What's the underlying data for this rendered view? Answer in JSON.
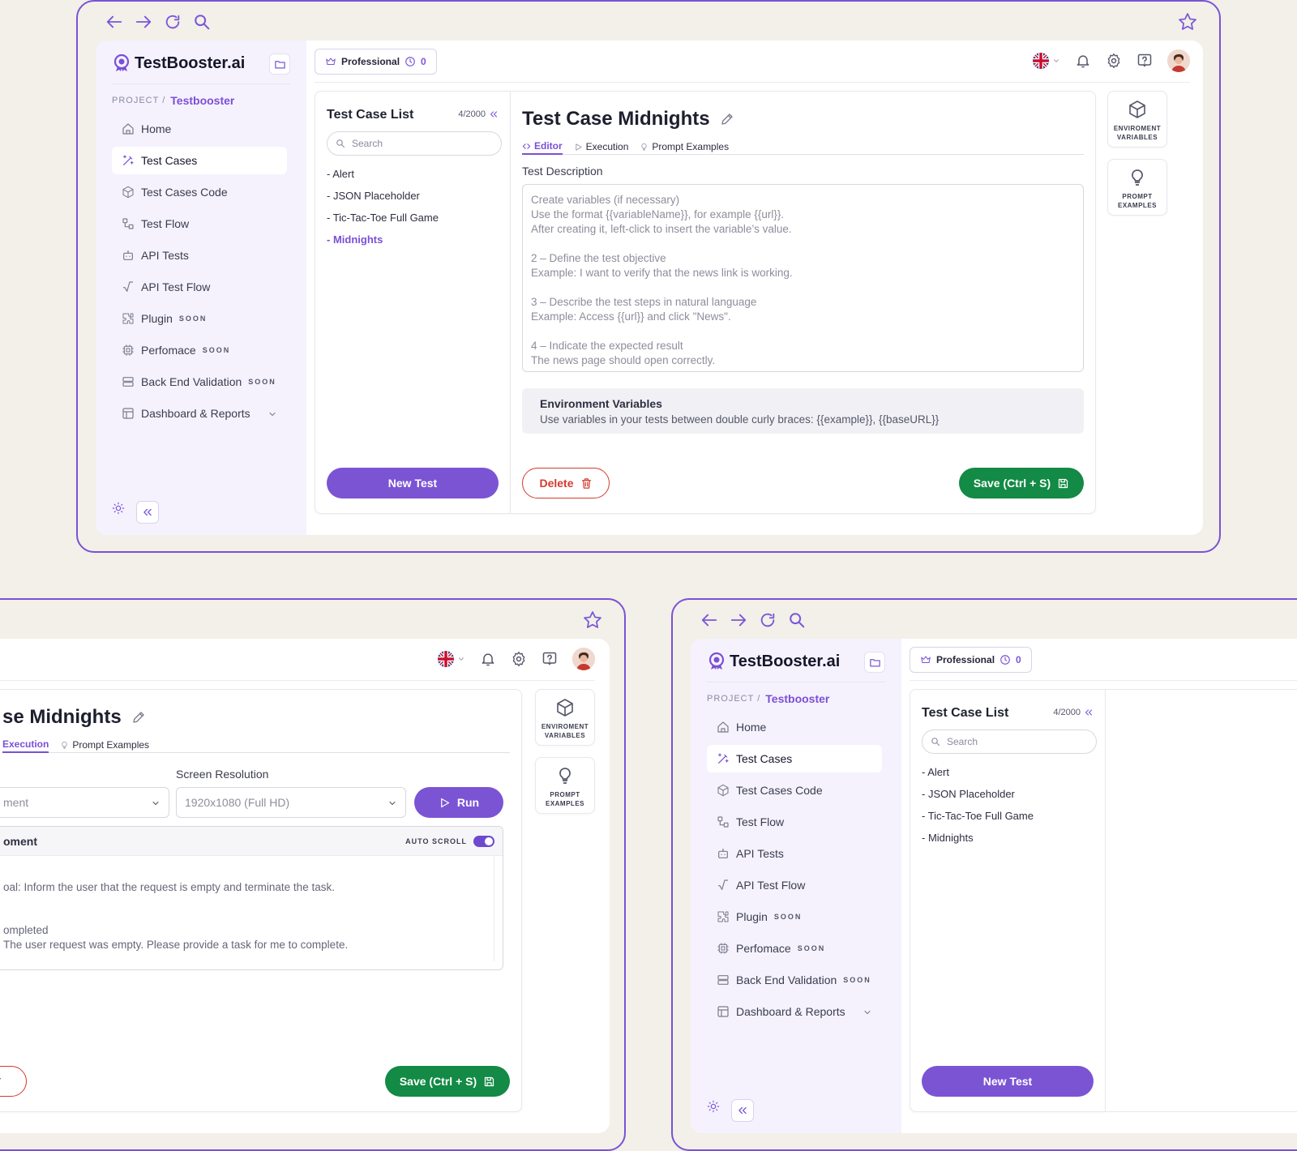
{
  "brand": {
    "name": "TestBooster.ai"
  },
  "project": {
    "label": "PROJECT /",
    "name": "Testbooster"
  },
  "sidebar": {
    "items": [
      {
        "label": "Home",
        "badge": ""
      },
      {
        "label": "Test Cases",
        "badge": ""
      },
      {
        "label": "Test Cases Code",
        "badge": ""
      },
      {
        "label": "Test Flow",
        "badge": ""
      },
      {
        "label": "API Tests",
        "badge": ""
      },
      {
        "label": "API Test Flow",
        "badge": ""
      },
      {
        "label": "Plugin",
        "badge": "SOON"
      },
      {
        "label": "Perfomace",
        "badge": "SOON"
      },
      {
        "label": "Back End Validation",
        "badge": "SOON"
      },
      {
        "label": "Dashboard & Reports",
        "badge": ""
      }
    ]
  },
  "topbar": {
    "plan": "Professional",
    "credits": "0"
  },
  "list": {
    "title": "Test Case List",
    "count": "4/2000",
    "search_placeholder": "Search",
    "items": [
      "- Alert",
      "- JSON Placeholder",
      "- Tic-Tac-Toe Full Game",
      "- Midnights"
    ],
    "new_button": "New Test"
  },
  "editor": {
    "title": "Test Case Midnights",
    "tabs": [
      "Editor",
      "Execution",
      "Prompt Examples"
    ],
    "desc_label": "Test Description",
    "desc_placeholder": "Create variables (if necessary)\nUse the format {{variableName}}, for example {{url}}.\nAfter creating it, left-click to insert the variable’s value.\n\n2 – Define the test objective\nExample: I want to verify that the news link is working.\n\n3 – Describe the test steps in natural language\nExample: Access {{url}} and click \"News\".\n\n4 – Indicate the expected result\nThe news page should open correctly.",
    "env_title": "Environment Variables",
    "env_desc": "Use variables in your tests between double curly braces: {{example}}, {{baseURL}}",
    "delete_button": "Delete",
    "save_button": "Save (Ctrl + S)"
  },
  "right_cards": {
    "env": "ENVIROMENT VARIABLES",
    "prompt": "PROMPT EXAMPLES"
  },
  "execution": {
    "title_partial": "se Midnights",
    "tab_partial": "Execution",
    "tab_prompt": "Prompt Examples",
    "resolution_label": "Screen Resolution",
    "environment_partial": "ment",
    "resolution_value": "1920x1080 (Full HD)",
    "run_button": "Run",
    "log_title_partial": "oment",
    "auto_scroll": "AUTO SCROLL",
    "log_line1": "oal: Inform the user that the request is empty and terminate the task.",
    "log_line2": "ompleted",
    "log_line3": "The user request was empty. Please provide a task for me to complete.",
    "save_button": "Save (Ctrl + S)"
  },
  "colors": {
    "accent": "#7b54d4",
    "save": "#138a45",
    "delete": "#d33b2c",
    "frame": "#7a52d6"
  }
}
